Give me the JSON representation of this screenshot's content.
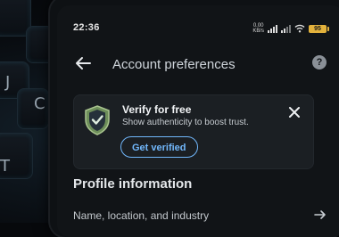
{
  "status_bar": {
    "time": "22:36",
    "net_speed_value": "0.00",
    "net_speed_unit": "KB/s",
    "battery": "95"
  },
  "keyboard": {
    "keys": [
      "J",
      "C",
      "T"
    ]
  },
  "app_bar": {
    "title": "Account preferences",
    "back_icon": "arrow-left-icon",
    "help_icon": "help-circle-icon"
  },
  "verify_card": {
    "title": "Verify for free",
    "subtitle": "Show authenticity to boost trust.",
    "button_label": "Get verified",
    "shield_icon": "verified-shield-icon",
    "close_icon": "close-icon",
    "accent_color": "#71b7fb"
  },
  "profile_section": {
    "title": "Profile information",
    "items": [
      {
        "label": "Name, location, and industry",
        "icon": "arrow-right-icon"
      }
    ]
  }
}
